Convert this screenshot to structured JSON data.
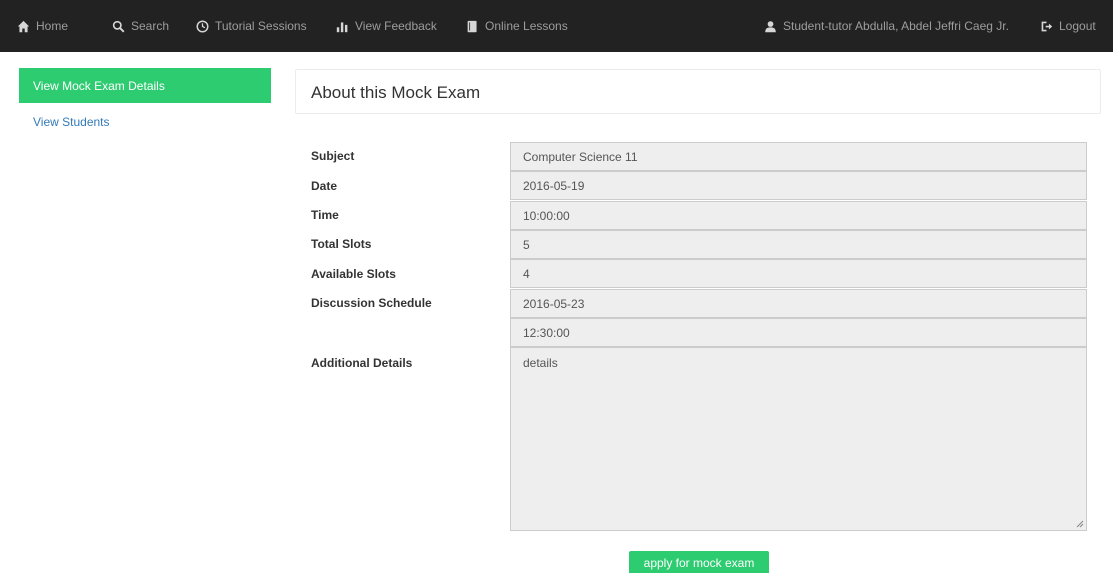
{
  "navbar": {
    "items": [
      {
        "label": "Home",
        "icon": "home-icon"
      },
      {
        "label": "Search",
        "icon": "search-icon"
      },
      {
        "label": "Tutorial Sessions",
        "icon": "clock-icon"
      },
      {
        "label": "View Feedback",
        "icon": "bar-chart-icon"
      },
      {
        "label": "Online Lessons",
        "icon": "book-icon"
      }
    ],
    "user": {
      "label": "Student-tutor Abdulla, Abdel Jeffri Caeg Jr.",
      "icon": "user-icon"
    },
    "logout": {
      "label": "Logout",
      "icon": "logout-icon"
    }
  },
  "sidebar": {
    "active_item": "View Mock Exam Details",
    "items": [
      "View Students"
    ]
  },
  "panel": {
    "title": "About this Mock Exam"
  },
  "form": {
    "subject": {
      "label": "Subject",
      "value": "Computer Science 11"
    },
    "date": {
      "label": "Date",
      "value": "2016-05-19"
    },
    "time": {
      "label": "Time",
      "value": "10:00:00"
    },
    "total_slots": {
      "label": "Total Slots",
      "value": "5"
    },
    "available_slots": {
      "label": "Available Slots",
      "value": "4"
    },
    "discussion_schedule": {
      "label": "Discussion Schedule",
      "date": "2016-05-23",
      "time": "12:30:00"
    },
    "additional_details": {
      "label": "Additional Details",
      "value": "details"
    }
  },
  "apply_button": "apply for mock exam",
  "colors": {
    "navbar": "#222222",
    "accent": "#2ecc71",
    "link": "#337ab7",
    "field_bg": "#eeeeee"
  }
}
